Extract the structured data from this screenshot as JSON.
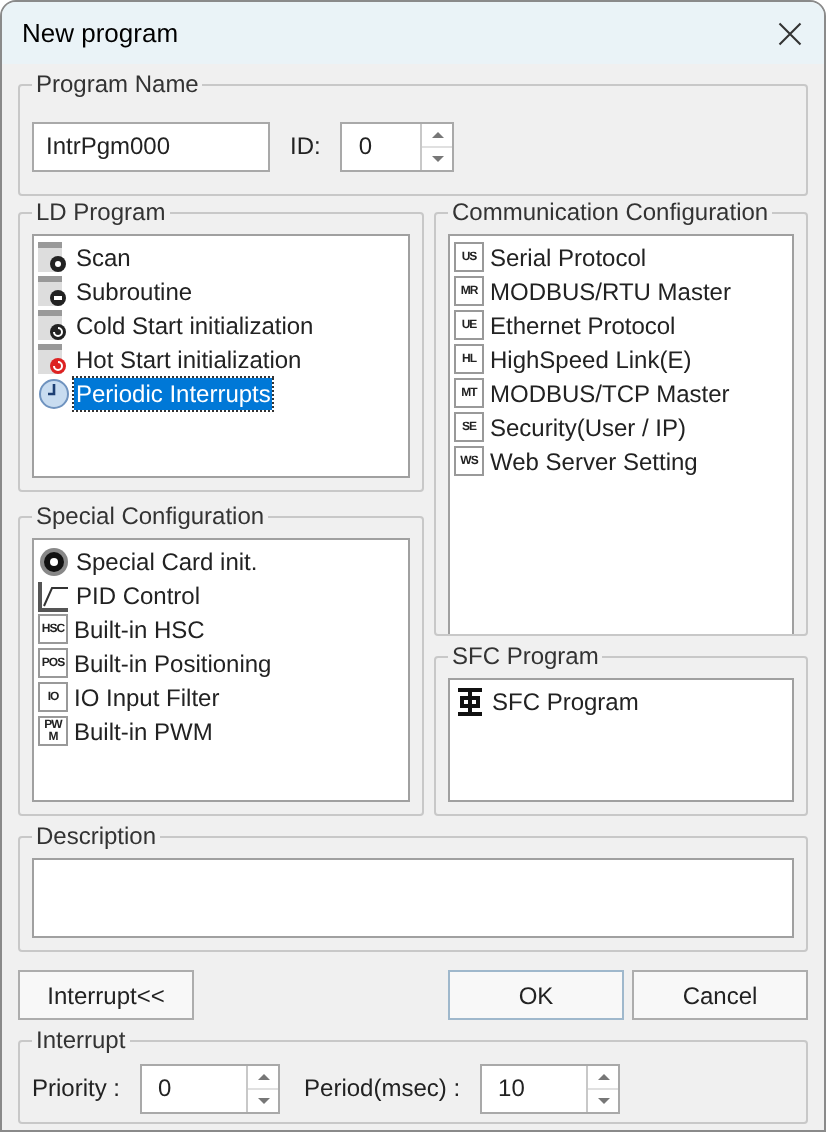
{
  "window": {
    "title": "New program"
  },
  "program_name": {
    "legend": "Program Name",
    "name_value": "IntrPgm000",
    "id_label": "ID:",
    "id_value": "0"
  },
  "ld_program": {
    "legend": "LD Program",
    "items": [
      {
        "label": "Scan",
        "kind": "scan",
        "selected": false
      },
      {
        "label": "Subroutine",
        "kind": "subroutine",
        "selected": false
      },
      {
        "label": "Cold Start initialization",
        "kind": "cold",
        "selected": false
      },
      {
        "label": "Hot Start initialization",
        "kind": "hot",
        "selected": false
      },
      {
        "label": "Periodic Interrupts",
        "kind": "clock",
        "selected": true
      }
    ]
  },
  "communication": {
    "legend": "Communication Configuration",
    "items": [
      {
        "label": "Serial Protocol",
        "badge": "US"
      },
      {
        "label": "MODBUS/RTU Master",
        "badge": "MR"
      },
      {
        "label": "Ethernet Protocol",
        "badge": "UE"
      },
      {
        "label": "HighSpeed Link(E)",
        "badge": "HL"
      },
      {
        "label": "MODBUS/TCP Master",
        "badge": "MT"
      },
      {
        "label": "Security(User / IP)",
        "badge": "SE"
      },
      {
        "label": "Web Server Setting",
        "badge": "WS"
      }
    ]
  },
  "special": {
    "legend": "Special Configuration",
    "items": [
      {
        "label": "Special Card init.",
        "kind": "card"
      },
      {
        "label": "PID Control",
        "kind": "pid"
      },
      {
        "label": "Built-in HSC",
        "kind": "badge",
        "badge": "HSC"
      },
      {
        "label": "Built-in Positioning",
        "kind": "badge",
        "badge": "POS"
      },
      {
        "label": "IO Input Filter",
        "kind": "badge",
        "badge": "IO"
      },
      {
        "label": "Built-in PWM",
        "kind": "badge",
        "badge": "PWM"
      }
    ]
  },
  "sfc": {
    "legend": "SFC Program",
    "items": [
      {
        "label": "SFC Program",
        "kind": "sfc"
      }
    ]
  },
  "description": {
    "legend": "Description"
  },
  "buttons": {
    "toggle": "Interrupt<<",
    "ok": "OK",
    "cancel": "Cancel"
  },
  "interrupt": {
    "legend": "Interrupt",
    "priority_label": "Priority :",
    "priority_value": "0",
    "period_label": "Period(msec) :",
    "period_value": "10"
  }
}
